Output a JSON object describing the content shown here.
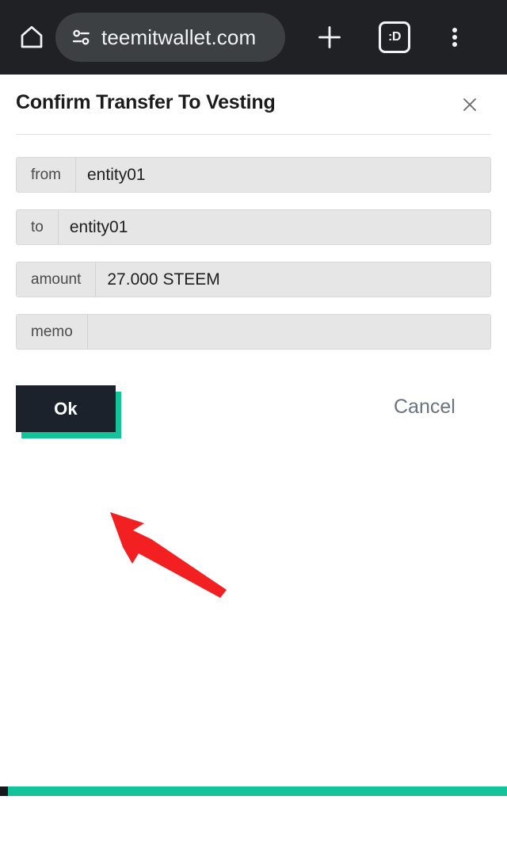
{
  "browser": {
    "home_icon": "home-icon",
    "page_info_icon": "page-info-sliders-icon",
    "url_text": "teemitwallet.com",
    "new_tab_icon": "plus-icon",
    "tab_count_label": ":D",
    "menu_icon": "three-dot-menu-icon",
    "chrome_bg": "#202124",
    "pill_bg": "#3c4043"
  },
  "dialog": {
    "title": "Confirm Transfer To Vesting",
    "close_icon": "close-x-icon",
    "fields": [
      {
        "label": "from",
        "value": "entity01"
      },
      {
        "label": "to",
        "value": "entity01"
      },
      {
        "label": "amount",
        "value": "27.000 STEEM"
      },
      {
        "label": "memo",
        "value": ""
      }
    ],
    "confirm_label": "Ok",
    "cancel_label": "Cancel",
    "accent_color": "#14c39a",
    "confirm_bg": "#1b222c"
  },
  "annotation": {
    "arrow_color": "#f22020",
    "arrow_name": "red-pointer-arrow"
  },
  "bottom_bar": {
    "color": "#14c39a",
    "marker_color": "#16181d"
  }
}
